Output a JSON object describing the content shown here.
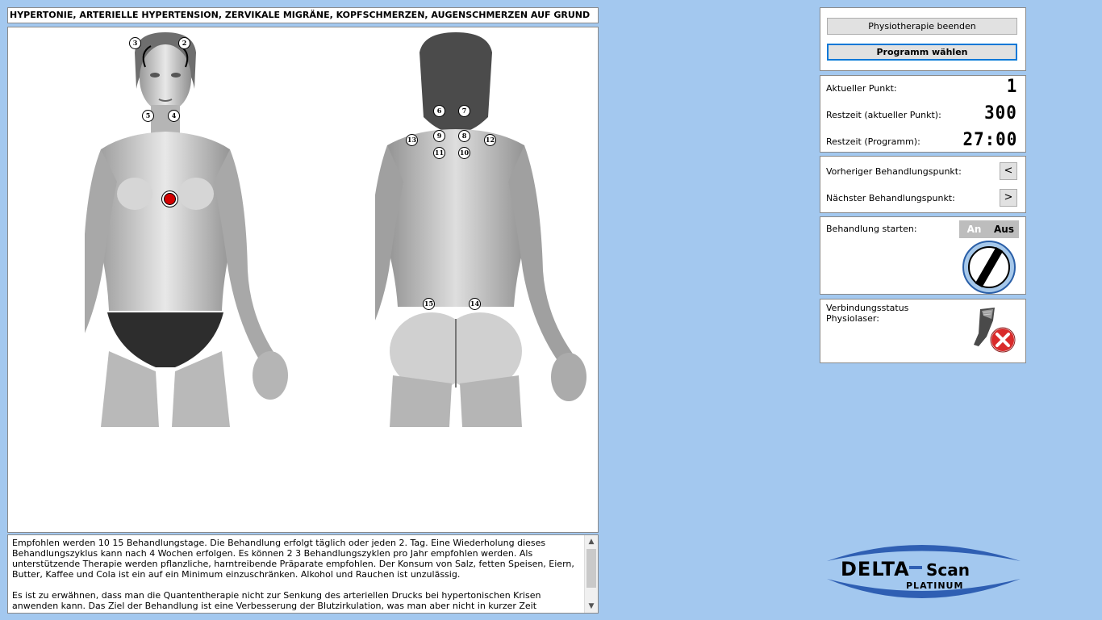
{
  "program_title": "HYPERTONIE, ARTERIELLE HYPERTENSION, ZERVIKALE MIGRÄNE, KOPFSCHMERZEN, AUGENSCHMERZEN AUF GRUND",
  "points_front": [
    "3",
    "2",
    "5",
    "4"
  ],
  "points_back": [
    "6",
    "7",
    "9",
    "8",
    "13",
    "12",
    "11",
    "10",
    "15",
    "14"
  ],
  "description": {
    "paragraph1": "Empfohlen werden 10  15 Behandlungstage. Die Behandlung erfolgt täglich oder jeden 2. Tag. Eine Wiederholung dieses Behandlungszyklus kann nach 4 Wochen erfolgen. Es können 2  3 Behandlungszyklen pro Jahr empfohlen werden. Als unterstützende Therapie werden pflanzliche, harntreibende Präparate empfohlen. Der Konsum von Salz, fetten Speisen, Eiern, Butter, Kaffee und Cola ist ein auf ein Minimum einzuschränken. Alkohol und Rauchen ist unzulässig.",
    "paragraph2": "Es ist zu erwähnen, dass man die Quantentherapie nicht zur Senkung des arteriellen Drucks bei hypertonischen Krisen anwenden kann. Das Ziel der Behandlung ist eine Verbesserung der Blutzirkulation, was man aber nicht in kurzer Zeit"
  },
  "controls": {
    "end_button": "Physiotherapie beenden",
    "select_button": "Programm wählen"
  },
  "timer": {
    "current_point_label": "Aktueller Punkt:",
    "current_point_value": "1",
    "remaining_point_label": "Restzeit (aktueller Punkt):",
    "remaining_point_value": "300",
    "remaining_program_label": "Restzeit (Programm):",
    "remaining_program_value": "27:00"
  },
  "navigation": {
    "prev_label": "Vorheriger Behandlungspunkt:",
    "prev_button": "<",
    "next_label": "Nächster Behandlungspunkt:",
    "next_button": ">"
  },
  "treatment": {
    "start_label": "Behandlung starten:",
    "toggle_on": "An",
    "toggle_off": "Aus",
    "state": "off"
  },
  "connection": {
    "status_label_line1": "Verbindungsstatus",
    "status_label_line2": "Physiolaser:",
    "connected": false
  },
  "logo": {
    "name": "DELTA-Scan",
    "subtitle": "PLATINUM"
  },
  "colors": {
    "background": "#a3c8ef",
    "active_point": "#d40000",
    "focus_border": "#0078d7",
    "disconnected": "#d92b2b"
  },
  "icons": [
    "power-knob-icon",
    "laser-device-icon",
    "disconnected-x-icon",
    "scroll-up-icon",
    "scroll-down-icon"
  ]
}
